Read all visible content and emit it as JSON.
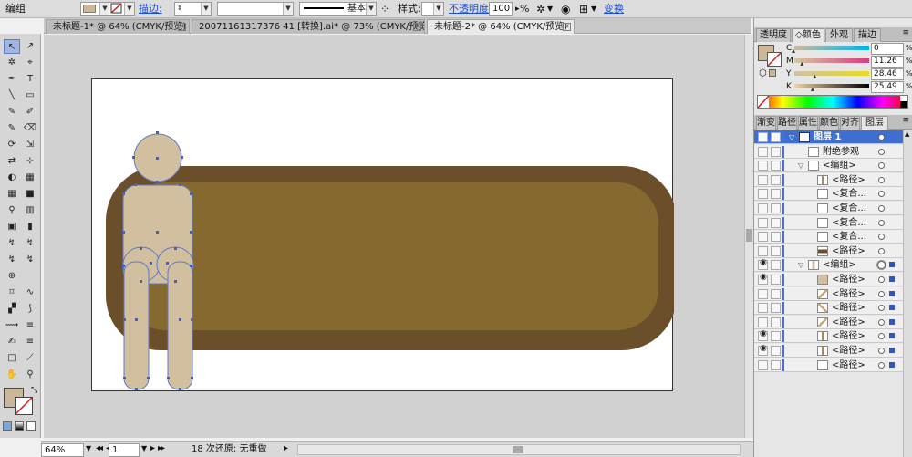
{
  "control_bar": {
    "selection_type": "编组",
    "stroke_label": "描边:",
    "stroke_profile": "基本",
    "style_label": "样式:",
    "opacity_label": "不透明度:",
    "opacity_value": "100",
    "opacity_unit": "%",
    "transform_label": "变换"
  },
  "tabs": [
    {
      "label": "未标题-1* @ 64% (CMYK/预览)",
      "active": false
    },
    {
      "label": "20071161317376 41 [转换].ai* @ 73% (CMYK/预览)",
      "active": false
    },
    {
      "label": "未标题-2* @ 64% (CMYK/预览)",
      "active": true
    }
  ],
  "tools": [
    [
      "↖",
      "↗"
    ],
    [
      "✲",
      "⌖"
    ],
    [
      "✒",
      "T"
    ],
    [
      "╲",
      "▭"
    ],
    [
      "✎",
      "✐"
    ],
    [
      "✎",
      "⌫"
    ],
    [
      "⟳",
      "⇲"
    ],
    [
      "⇄",
      "⊹"
    ],
    [
      "◐",
      "▦"
    ],
    [
      "▦",
      "■"
    ],
    [
      "⚲",
      "▥"
    ],
    [
      "▣",
      "▮"
    ],
    [
      "↯",
      "↯"
    ],
    [
      "↯",
      "↯"
    ],
    [
      "⊕",
      ""
    ],
    [
      "⌑",
      "∿"
    ],
    [
      "▞",
      "⟆"
    ],
    [
      "⟿",
      "≡"
    ],
    [
      "✍",
      "≡"
    ],
    [
      "□",
      "⟋"
    ],
    [
      "✋",
      "⚲"
    ]
  ],
  "status_bar": {
    "zoom": "64%",
    "artboard_number": "1",
    "status_text": "18 次还原; 无重做"
  },
  "color_panel": {
    "tabs": [
      "透明度",
      "◇颜色",
      "外观",
      "描边"
    ],
    "active_tab": 1,
    "sliders": [
      {
        "label": "C",
        "value": "0",
        "marker_pct": 0
      },
      {
        "label": "M",
        "value": "11.26",
        "marker_pct": 11.26
      },
      {
        "label": "Y",
        "value": "28.46",
        "marker_pct": 28.46
      },
      {
        "label": "K",
        "value": "25.49",
        "marker_pct": 25.49
      }
    ],
    "fill_color": "#cdb79a",
    "track_colors": {
      "C": [
        "#cdb79a",
        "#00b3ec"
      ],
      "M": [
        "#d8c7a2",
        "#d83c82"
      ],
      "Y": [
        "#cfc1a8",
        "#e6dc1e"
      ],
      "K": [
        "#ecd3a8",
        "#000000"
      ]
    }
  },
  "layers_panel": {
    "tabs": [
      "渐变",
      "路径",
      "属性",
      "颜色",
      "对齐",
      "图层"
    ],
    "active_tab": 5,
    "rows": [
      {
        "label": "图层 1",
        "indent": 0,
        "selected": true,
        "twirl": "▽",
        "eye": false,
        "thumb": "layer",
        "target": "single",
        "square": false
      },
      {
        "label": "附绝参观",
        "indent": 1,
        "selected": false,
        "twirl": "",
        "eye": false,
        "thumb": "blank",
        "target": "single",
        "square": false
      },
      {
        "label": "<编组>",
        "indent": 1,
        "selected": false,
        "twirl": "▽",
        "eye": false,
        "thumb": "blank",
        "target": "single",
        "square": false
      },
      {
        "label": "<路径>",
        "indent": 2,
        "selected": false,
        "twirl": "",
        "eye": false,
        "thumb": "bar",
        "target": "single",
        "square": false
      },
      {
        "label": "<复合...",
        "indent": 2,
        "selected": false,
        "twirl": "",
        "eye": false,
        "thumb": "blank",
        "target": "single",
        "square": false
      },
      {
        "label": "<复合...",
        "indent": 2,
        "selected": false,
        "twirl": "",
        "eye": false,
        "thumb": "blank",
        "target": "single",
        "square": false
      },
      {
        "label": "<复合...",
        "indent": 2,
        "selected": false,
        "twirl": "",
        "eye": false,
        "thumb": "blank",
        "target": "single",
        "square": false
      },
      {
        "label": "<复合...",
        "indent": 2,
        "selected": false,
        "twirl": "",
        "eye": false,
        "thumb": "blank",
        "target": "single",
        "square": false
      },
      {
        "label": "<路径>",
        "indent": 2,
        "selected": false,
        "twirl": "",
        "eye": false,
        "thumb": "brownbar",
        "target": "single",
        "square": false
      },
      {
        "label": "<编组>",
        "indent": 1,
        "selected": false,
        "twirl": "▽",
        "eye": true,
        "thumb": "figure",
        "target": "double",
        "square": true
      },
      {
        "label": "<路径>",
        "indent": 2,
        "selected": false,
        "twirl": "",
        "eye": true,
        "thumb": "tan",
        "target": "single",
        "square": true
      },
      {
        "label": "<路径>",
        "indent": 2,
        "selected": false,
        "twirl": "",
        "eye": false,
        "thumb": "slash",
        "target": "single",
        "square": true
      },
      {
        "label": "<路径>",
        "indent": 2,
        "selected": false,
        "twirl": "",
        "eye": false,
        "thumb": "slash2",
        "target": "single",
        "square": true
      },
      {
        "label": "<路径>",
        "indent": 2,
        "selected": false,
        "twirl": "",
        "eye": false,
        "thumb": "slash",
        "target": "single",
        "square": true
      },
      {
        "label": "<路径>",
        "indent": 2,
        "selected": false,
        "twirl": "",
        "eye": true,
        "thumb": "bar",
        "target": "single",
        "square": true
      },
      {
        "label": "<路径>",
        "indent": 2,
        "selected": false,
        "twirl": "",
        "eye": true,
        "thumb": "bar",
        "target": "single",
        "square": true
      },
      {
        "label": "<路径>",
        "indent": 2,
        "selected": false,
        "twirl": "",
        "eye": false,
        "thumb": "blank",
        "target": "single",
        "square": true
      }
    ]
  }
}
